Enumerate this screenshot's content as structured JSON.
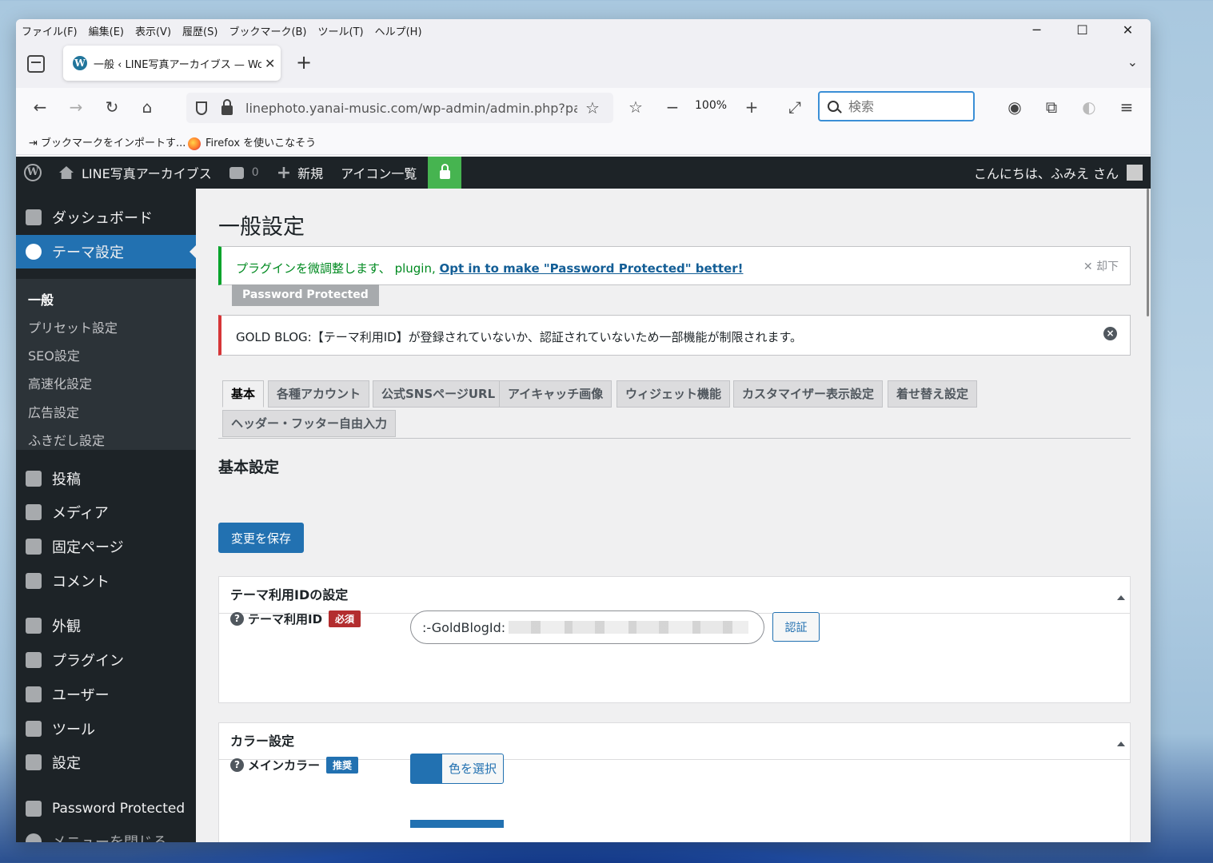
{
  "browser": {
    "menu": [
      "ファイル(F)",
      "編集(E)",
      "表示(V)",
      "履歴(S)",
      "ブックマーク(B)",
      "ツール(T)",
      "ヘルプ(H)"
    ],
    "tab_title": "一般 ‹ LINE写真アーカイブス — WordPress",
    "url": "linephoto.yanai-music.com/wp-admin/admin.php?page=gold-blog",
    "zoom": "100%",
    "search_placeholder": "検索",
    "bookmarks": [
      "ブックマークをインポートす...",
      "Firefox を使いこなそう"
    ]
  },
  "adminbar": {
    "site": "LINE写真アーカイブス",
    "comments": "0",
    "new": "新規",
    "icons": "アイコン一覧",
    "howdy": "こんにちは、ふみえ さん"
  },
  "sidebar": {
    "dashboard": "ダッシュボード",
    "theme": "テーマ設定",
    "sub": [
      "一般",
      "プリセット設定",
      "SEO設定",
      "高速化設定",
      "広告設定",
      "ふきだし設定"
    ],
    "items": [
      "投稿",
      "メディア",
      "固定ページ",
      "コメント",
      "外観",
      "プラグイン",
      "ユーザー",
      "ツール",
      "設定",
      "Password Protected",
      "メニューを閉じる"
    ]
  },
  "main": {
    "title": "一般設定",
    "notice1_text": "プラグインを微調整します、 plugin, ",
    "notice1_link": "Opt in to make \"Password Protected\" better!",
    "notice1_dismiss": "✕ 却下",
    "badge": "Password Protected",
    "notice2": "GOLD BLOG:【テーマ利用ID】が登録されていないか、認証されていないため一部機能が制限されます。",
    "tabs": [
      "基本",
      "各種アカウント",
      "公式SNSページURL",
      "アイキャッチ画像",
      "ウィジェット機能",
      "カスタマイザー表示設定",
      "着せ替え設定",
      "ヘッダー・フッター自由入力"
    ],
    "section": "基本設定",
    "save": "変更を保存",
    "box1_title": "テーマ利用IDの設定",
    "id_label": "テーマ利用ID",
    "required": "必須",
    "id_value": ":-GoldBlogId:",
    "verify": "認証",
    "box2_title": "カラー設定",
    "main_color": "メインカラー",
    "recommended": "推奨",
    "choose_color": "色を選択"
  },
  "colors": {
    "wp_dark": "#1d2327",
    "wp_blue": "#2271b1",
    "success": "#00a32a",
    "error": "#d63638"
  }
}
